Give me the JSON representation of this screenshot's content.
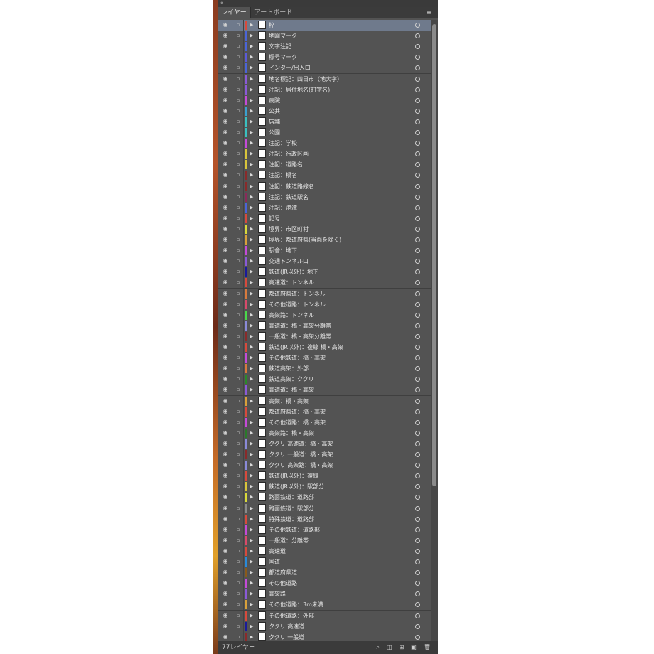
{
  "panel": {
    "tabs": [
      {
        "label": "レイヤー",
        "active": true
      },
      {
        "label": "アートボード",
        "active": false
      }
    ],
    "layer_count_label": "77レイヤー",
    "selected_index": 0
  },
  "layers": [
    {
      "name": "枠",
      "color": "#d84a3c"
    },
    {
      "name": "地図マーク",
      "color": "#4a64d8"
    },
    {
      "name": "文字注記",
      "color": "#4a64d8"
    },
    {
      "name": "標号マーク",
      "color": "#5a5ad8"
    },
    {
      "name": "インター/出入口",
      "color": "#4a64d8"
    },
    {
      "name": "地名標記：四日市（地大字）",
      "color": "#8a5ad8"
    },
    {
      "name": "注記：居住地名(町字名)",
      "color": "#8a5ad8"
    },
    {
      "name": "病院",
      "color": "#c44ad8"
    },
    {
      "name": "公共",
      "color": "#3aa0d0"
    },
    {
      "name": "店舗",
      "color": "#3ac0c0"
    },
    {
      "name": "公園",
      "color": "#3ac0c0"
    },
    {
      "name": "注記：学校",
      "color": "#c44ad8"
    },
    {
      "name": "注記：行政区画",
      "color": "#d8c43a"
    },
    {
      "name": "注記：道路名",
      "color": "#d8c43a"
    },
    {
      "name": "注記：橋名",
      "color": "#8a2a2a"
    },
    {
      "name": "注記：鉄道路線名",
      "color": "#8a2a2a"
    },
    {
      "name": "注記：鉄道駅名",
      "color": "#8a2a5a"
    },
    {
      "name": "注記：港湾",
      "color": "#4a64d8"
    },
    {
      "name": "記号",
      "color": "#d84a3c"
    },
    {
      "name": "境界：市区町村",
      "color": "#d8d83a"
    },
    {
      "name": "境界：都道府県(当面を除く)",
      "color": "#d8a03a"
    },
    {
      "name": "駅舎：地下",
      "color": "#c44ad8"
    },
    {
      "name": "交通トンネル口",
      "color": "#8a5ad8"
    },
    {
      "name": "鉄道(JR以外)：地下",
      "color": "#1a1a9a"
    },
    {
      "name": "高速道：トンネル",
      "color": "#d84a3c"
    },
    {
      "name": "都道府県道：トンネル",
      "color": "#d87a3c"
    },
    {
      "name": "その他道路：トンネル",
      "color": "#d84a6a"
    },
    {
      "name": "高架路：トンネル",
      "color": "#4ad84a"
    },
    {
      "name": "高速道：橋・高架分離帯",
      "color": "#8a8ad8"
    },
    {
      "name": "一般道：橋・高架分離帯",
      "color": "#8a2a2a"
    },
    {
      "name": "鉄道(JR以外)：複線 橋・高架",
      "color": "#d84a3c"
    },
    {
      "name": "その他鉄道：橋・高架",
      "color": "#c44ad8"
    },
    {
      "name": "鉄道高架：外部",
      "color": "#d87a3c"
    },
    {
      "name": "鉄道高架：ククリ",
      "color": "#2a8a2a"
    },
    {
      "name": "高速道：橋・高架",
      "color": "#8a5ad8"
    },
    {
      "name": "高架：橋・高架",
      "color": "#d8a03a"
    },
    {
      "name": "都道府県道：橋・高架",
      "color": "#d84a3c"
    },
    {
      "name": "その他道路：橋・高架",
      "color": "#c44ad8"
    },
    {
      "name": "高架路：橋・高架",
      "color": "#2a7a2a"
    },
    {
      "name": "ククリ 高速道：橋・高架",
      "color": "#8a8ad8"
    },
    {
      "name": "ククリ 一般道：橋・高架",
      "color": "#8a2a2a"
    },
    {
      "name": "ククリ 高架路：橋・高架",
      "color": "#8a8ad8"
    },
    {
      "name": "鉄道(JR以外)：複線",
      "color": "#d84a3c"
    },
    {
      "name": "鉄道(JR以外)：駅部分",
      "color": "#d8c43a"
    },
    {
      "name": "路面鉄道：道路部",
      "color": "#d8d83a"
    },
    {
      "name": "路面鉄道：駅部分",
      "color": "#8a8a8a"
    },
    {
      "name": "特殊鉄道：道路部",
      "color": "#d84a3c"
    },
    {
      "name": "その他鉄道：道路部",
      "color": "#c44ad8"
    },
    {
      "name": "一般道：分離帯",
      "color": "#d84a6a"
    },
    {
      "name": "高速道",
      "color": "#d84a3c"
    },
    {
      "name": "国道",
      "color": "#2a8ad8"
    },
    {
      "name": "都道府県道",
      "color": "#8a5a1a"
    },
    {
      "name": "その他道路",
      "color": "#c44ad8"
    },
    {
      "name": "高架路",
      "color": "#8a5ad8"
    },
    {
      "name": "その他道路：3m未満",
      "color": "#d8a03a"
    },
    {
      "name": "その他道路：外部",
      "color": "#d84a3c"
    },
    {
      "name": "ククリ 高速道",
      "color": "#1a1a9a"
    },
    {
      "name": "ククリ 一般道",
      "color": "#8a2a2a"
    }
  ]
}
